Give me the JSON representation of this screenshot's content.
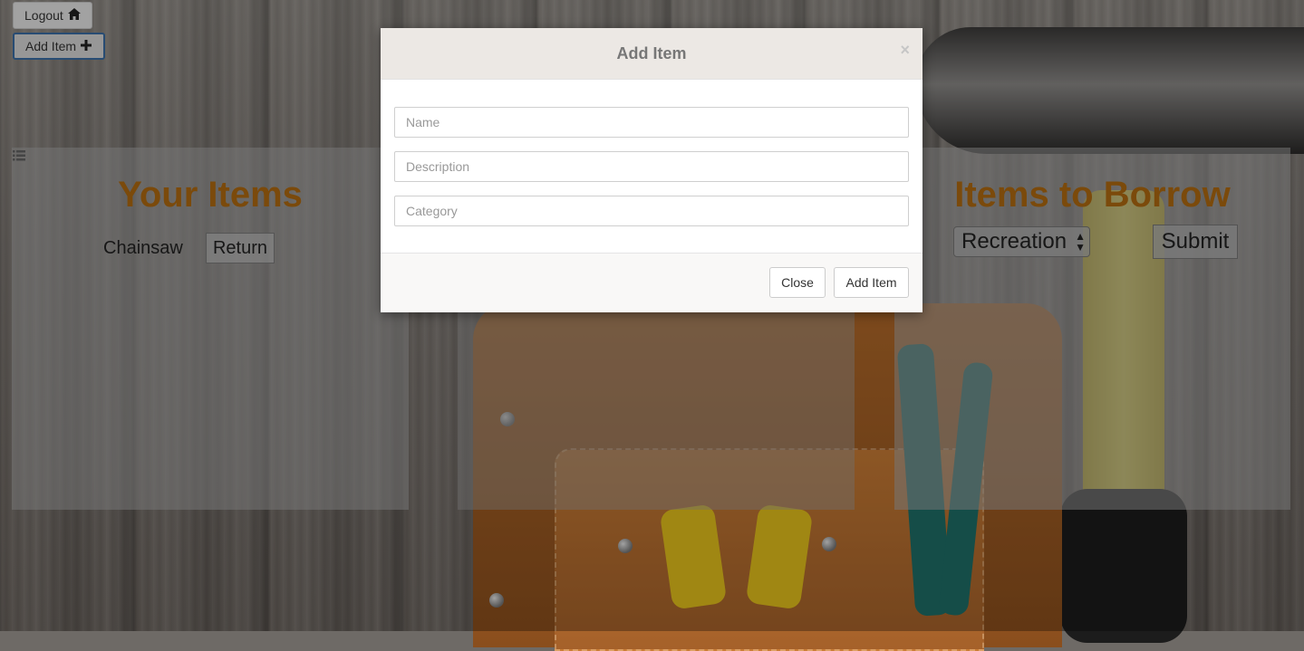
{
  "topbar": {
    "logout_label": "Logout",
    "logout_icon": "home-icon",
    "add_item_label": "Add Item",
    "add_item_icon": "plus-icon"
  },
  "left_panel": {
    "title": "Your Items",
    "items": [
      {
        "name": "Chainsaw",
        "action_label": "Return"
      }
    ]
  },
  "right_panel": {
    "title": "Items to Borrow",
    "category_selected": "Recreation",
    "submit_label": "Submit"
  },
  "modal": {
    "title": "Add Item",
    "close_symbol": "×",
    "fields": {
      "name_placeholder": "Name",
      "description_placeholder": "Description",
      "category_placeholder": "Category"
    },
    "close_label": "Close",
    "add_label": "Add Item"
  },
  "colors": {
    "heading_accent": "#b06a10",
    "modal_header_bg": "#ece8e4"
  }
}
